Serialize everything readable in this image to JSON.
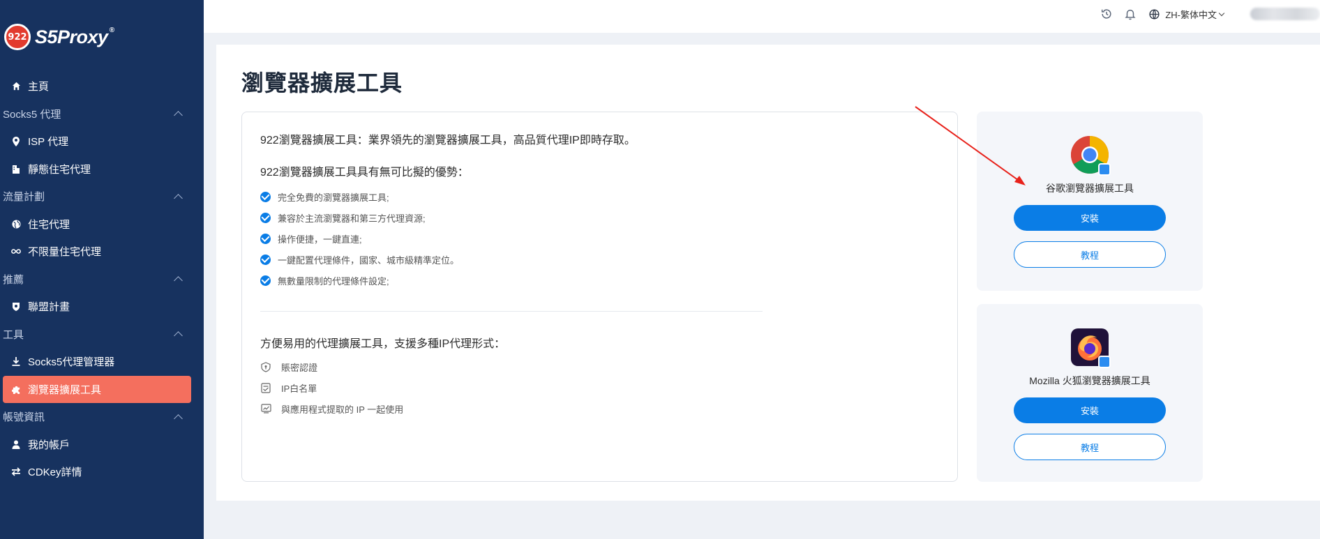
{
  "logo": {
    "badge": "922",
    "name": "S5Proxy",
    "reg": "®"
  },
  "sidebar": {
    "items": [
      {
        "type": "item",
        "label": "主頁",
        "icon": "home-icon"
      },
      {
        "type": "section",
        "label": "Socks5 代理"
      },
      {
        "type": "item",
        "label": "ISP 代理",
        "icon": "location-pin-icon"
      },
      {
        "type": "item",
        "label": "靜態住宅代理",
        "icon": "building-icon"
      },
      {
        "type": "section",
        "label": "流量計劃"
      },
      {
        "type": "item",
        "label": "住宅代理",
        "icon": "globe-icon"
      },
      {
        "type": "item",
        "label": "不限量住宅代理",
        "icon": "infinity-icon"
      },
      {
        "type": "section",
        "label": "推薦"
      },
      {
        "type": "item",
        "label": "聯盟計畫",
        "icon": "shield-badge-icon"
      },
      {
        "type": "section",
        "label": "工具"
      },
      {
        "type": "item",
        "label": "Socks5代理管理器",
        "icon": "download-icon"
      },
      {
        "type": "item",
        "label": "瀏覽器擴展工具",
        "icon": "puzzle-icon",
        "active": true
      },
      {
        "type": "section",
        "label": "帳號資訊"
      },
      {
        "type": "item",
        "label": "我的帳戶",
        "icon": "user-icon"
      },
      {
        "type": "item",
        "label": "CDKey詳情",
        "icon": "swap-icon"
      }
    ]
  },
  "topbar": {
    "language": "ZH-繁体中文"
  },
  "page": {
    "title": "瀏覽器擴展工具",
    "intro": "922瀏覽器擴展工具：業界領先的瀏覽器擴展工具，高品質代理IP即時存取。",
    "advantages_title": "922瀏覽器擴展工具具有無可比擬的優勢：",
    "advantages": [
      "完全免費的瀏覽器擴展工具;",
      "兼容於主流瀏覽器和第三方代理資源;",
      "操作便捷，一鍵直連;",
      "一鍵配置代理條件，國家、城市級精準定位。",
      "無數量限制的代理條件設定;"
    ],
    "convenience_title": "方便易用的代理擴展工具，支援多種IP代理形式：",
    "convenience": [
      {
        "label": "賬密認證",
        "icon": "shield-lock-icon"
      },
      {
        "label": "IP白名單",
        "icon": "checklist-icon"
      },
      {
        "label": "與應用程式提取的 IP 一起使用",
        "icon": "chart-window-icon"
      }
    ]
  },
  "extensions": {
    "chrome": {
      "name": "谷歌瀏覽器擴展工具",
      "install": "安裝",
      "tutorial": "教程"
    },
    "firefox": {
      "name": "Mozilla 火狐瀏覽器擴展工具",
      "install": "安裝",
      "tutorial": "教程"
    }
  },
  "colors": {
    "sidebar_bg": "#17325f",
    "active_item": "#f46f5e",
    "primary": "#0a7de6",
    "annotation_arrow": "#e8221b"
  }
}
